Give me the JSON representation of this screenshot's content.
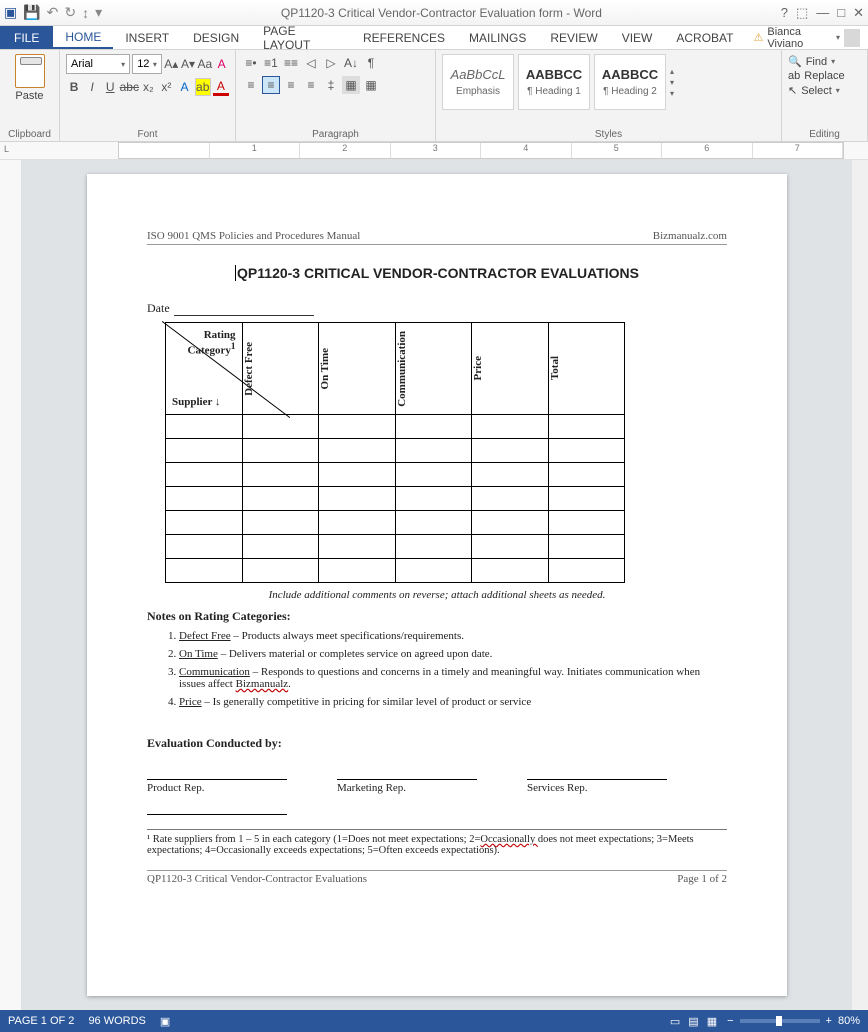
{
  "title_bar": {
    "doc_title": "QP1120-3 Critical Vendor-Contractor Evaluation form - Word"
  },
  "tabs": {
    "file": "FILE",
    "home": "HOME",
    "insert": "INSERT",
    "design": "DESIGN",
    "page_layout": "PAGE LAYOUT",
    "references": "REFERENCES",
    "mailings": "MAILINGS",
    "review": "REVIEW",
    "view": "VIEW",
    "acrobat": "ACROBAT",
    "user": "Bianca Viviano"
  },
  "ribbon": {
    "clipboard": {
      "paste": "Paste",
      "label": "Clipboard"
    },
    "font": {
      "name": "Arial",
      "size": "12",
      "label": "Font"
    },
    "paragraph": {
      "label": "Paragraph"
    },
    "styles": {
      "s1_preview": "AaBbCcL",
      "s1_name": "Emphasis",
      "s2_preview": "AABBCC",
      "s2_name": "¶ Heading 1",
      "s3_preview": "AABBCC",
      "s3_name": "¶ Heading 2",
      "label": "Styles"
    },
    "editing": {
      "find": "Find",
      "replace": "Replace",
      "select": "Select",
      "label": "Editing"
    }
  },
  "ruler": {
    "nums": [
      "",
      "1",
      "2",
      "3",
      "4",
      "5",
      "6",
      "7"
    ]
  },
  "doc": {
    "header_left": "ISO 9001 QMS Policies and Procedures Manual",
    "header_right": "Bizmanualz.com",
    "title": "QP1120-3 CRITICAL VENDOR-CONTRACTOR EVALUATIONS",
    "date_label": "Date",
    "table": {
      "rating_category": "Rating Category",
      "sup": "1",
      "supplier": "Supplier ↓",
      "cols": [
        "Defect Free",
        "On Time",
        "Communication",
        "Price",
        "Total"
      ]
    },
    "caption": "Include additional comments on reverse; attach additional sheets as needed.",
    "notes_heading": "Notes on Rating Categories:",
    "notes": [
      {
        "term": "Defect Free",
        "text": " – Products always meet specifications/requirements."
      },
      {
        "term": "On Time",
        "text": " – Delivers material or completes service on agreed upon date."
      },
      {
        "term": "Communication",
        "text": " – Responds to questions and concerns in a timely and meaningful way.  Initiates communication when issues affect ",
        "tail": "Bizmanualz",
        "after": "."
      },
      {
        "term": "Price",
        "text": " – Is generally competitive in pricing for similar level of product or service"
      }
    ],
    "eval_by": "Evaluation Conducted by:",
    "sigs": [
      "Product Rep.",
      "Marketing Rep.",
      "Services Rep."
    ],
    "footnote_pre": "¹ Rate suppliers from 1 – 5 in each category (1=Does not meet expectations; 2=",
    "footnote_wavy": "Occasionally ",
    "footnote_post": "does not meet expectations; 3=Meets expectations; 4=Occasionally exceeds expectations; 5=Often exceeds expectations).",
    "footer_left": "QP1120-3 Critical Vendor-Contractor Evaluations",
    "footer_right": "Page 1 of 2"
  },
  "status": {
    "page": "PAGE 1 OF 2",
    "words": "96 WORDS",
    "zoom": "80%"
  }
}
